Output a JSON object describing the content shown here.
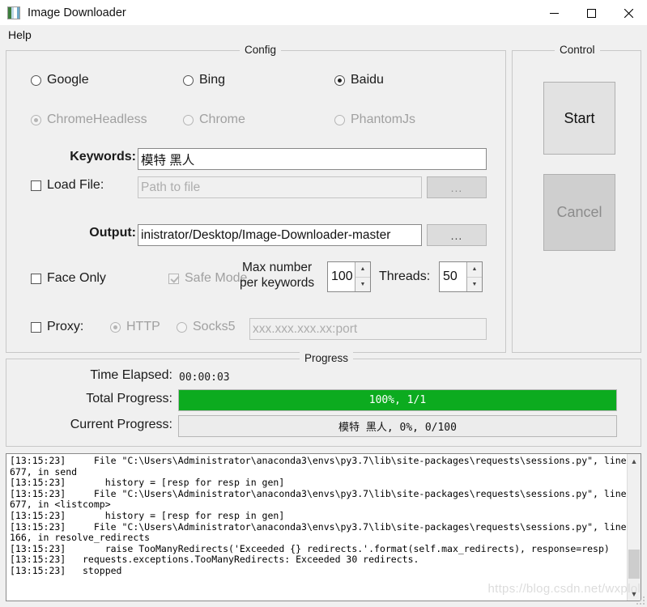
{
  "window": {
    "title": "Image Downloader",
    "icon": "image-icon",
    "minimize": "—",
    "maximize": "□",
    "close": "✕"
  },
  "menu": {
    "items": [
      {
        "label": "Help"
      }
    ]
  },
  "config": {
    "title": "Config",
    "engines": [
      {
        "label": "Google",
        "selected": false,
        "enabled": true
      },
      {
        "label": "Bing",
        "selected": false,
        "enabled": true
      },
      {
        "label": "Baidu",
        "selected": true,
        "enabled": true
      }
    ],
    "drivers": [
      {
        "label": "ChromeHeadless",
        "selected": true,
        "enabled": false
      },
      {
        "label": "Chrome",
        "selected": false,
        "enabled": false
      },
      {
        "label": "PhantomJs",
        "selected": false,
        "enabled": false
      }
    ],
    "keywords": {
      "label": "Keywords:",
      "value": "模特 黑人"
    },
    "load_file": {
      "label": "Load File:",
      "checked": false,
      "placeholder": "Path to file",
      "value": "",
      "browse_label": "..."
    },
    "output": {
      "label": "Output:",
      "value": "inistrator/Desktop/Image-Downloader-master",
      "browse_label": "..."
    },
    "face_only": {
      "label": "Face Only",
      "checked": false,
      "enabled": true
    },
    "safe_mode": {
      "label": "Safe Mode",
      "checked": true,
      "enabled": false
    },
    "max_number": {
      "label_line1": "Max number",
      "label_line2": "per keywords",
      "value": "100"
    },
    "threads": {
      "label": "Threads:",
      "value": "50"
    },
    "proxy": {
      "label": "Proxy:",
      "checked": false,
      "types": [
        {
          "label": "HTTP",
          "selected": true,
          "enabled": false
        },
        {
          "label": "Socks5",
          "selected": false,
          "enabled": false
        }
      ],
      "placeholder": "xxx.xxx.xxx.xx:port",
      "value": ""
    }
  },
  "control": {
    "title": "Control",
    "start_label": "Start",
    "cancel_label": "Cancel"
  },
  "progress": {
    "title": "Progress",
    "time_elapsed_label": "Time Elapsed:",
    "time_elapsed_value": "00:00:03",
    "total_label": "Total Progress:",
    "total_text": "100%,  1/1",
    "total_percent": 100,
    "current_label": "Current Progress:",
    "current_text": "模特 黑人, 0%,  0/100",
    "current_percent": 0,
    "bar_color": "#0cab1f"
  },
  "log": {
    "text": "[13:15:23]     File \"C:\\Users\\Administrator\\anaconda3\\envs\\py3.7\\lib\\site-packages\\requests\\sessions.py\", line 677, in send\n[13:15:23]       history = [resp for resp in gen]\n[13:15:23]     File \"C:\\Users\\Administrator\\anaconda3\\envs\\py3.7\\lib\\site-packages\\requests\\sessions.py\", line 677, in <listcomp>\n[13:15:23]       history = [resp for resp in gen]\n[13:15:23]     File \"C:\\Users\\Administrator\\anaconda3\\envs\\py3.7\\lib\\site-packages\\requests\\sessions.py\", line 166, in resolve_redirects\n[13:15:23]       raise TooManyRedirects('Exceeded {} redirects.'.format(self.max_redirects), response=resp)\n[13:15:23]   requests.exceptions.TooManyRedirects: Exceeded 30 redirects.\n[13:15:23]   stopped",
    "scroll_up": "▲",
    "scroll_down": "▼"
  },
  "watermark": {
    "text": "https://blog.csdn.net/wxplol"
  }
}
